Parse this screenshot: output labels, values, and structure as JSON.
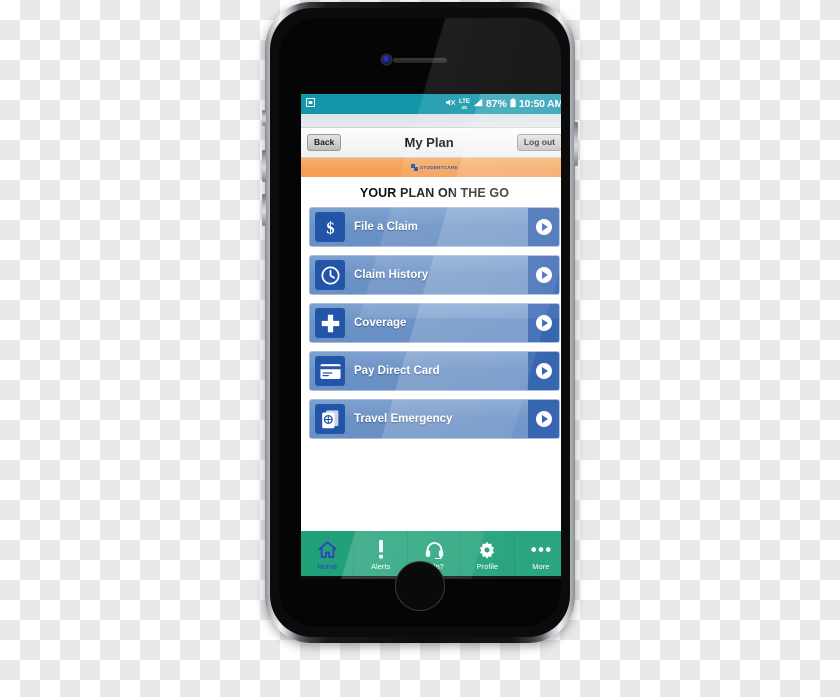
{
  "device": {
    "name": "smartphone-mockup",
    "home_button": "home-button",
    "earpiece": "earpiece-speaker",
    "camera": "front-camera"
  },
  "status_bar": {
    "notification_icon": "screenshot-icon",
    "mute_icon": "speaker-mute-icon",
    "network_label": "LTE",
    "network_sub": "4G",
    "signal_icon": "signal-bars-icon",
    "battery_percent": "87%",
    "battery_icon": "battery-icon",
    "time": "10:50 AM",
    "bg_color": "#1496ab"
  },
  "header": {
    "back_label": "Back",
    "title": "My Plan",
    "logout_label": "Log out"
  },
  "brand_banner": {
    "wordmark": "STUDENTCARE",
    "logo_icon": "studentcare-logo-icon",
    "bg_color": "#f4a259",
    "logo_color": "#1e4fa3"
  },
  "main": {
    "heading": "YOUR PLAN ON THE GO",
    "menu_items": [
      {
        "label": "File a Claim",
        "icon": "dollar-sign-icon"
      },
      {
        "label": "Claim History",
        "icon": "clock-icon"
      },
      {
        "label": "Coverage",
        "icon": "medical-cross-icon"
      },
      {
        "label": "Pay Direct Card",
        "icon": "credit-card-icon"
      },
      {
        "label": "Travel Emergency",
        "icon": "passport-icon"
      }
    ],
    "chevron_icon": "chevron-right-circle-icon",
    "button_color": "#6b92c6",
    "icon_box_color": "#2255a8"
  },
  "tab_bar": {
    "bg_color": "#21a179",
    "active_color": "#2f3fbf",
    "items": [
      {
        "label": "Home",
        "icon": "home-icon",
        "active": true
      },
      {
        "label": "Alerts",
        "icon": "exclamation-icon",
        "active": false
      },
      {
        "label": "Help?",
        "icon": "headset-icon",
        "active": false
      },
      {
        "label": "Profile",
        "icon": "gear-icon",
        "active": false
      },
      {
        "label": "More",
        "icon": "ellipsis-icon",
        "active": false
      }
    ]
  }
}
